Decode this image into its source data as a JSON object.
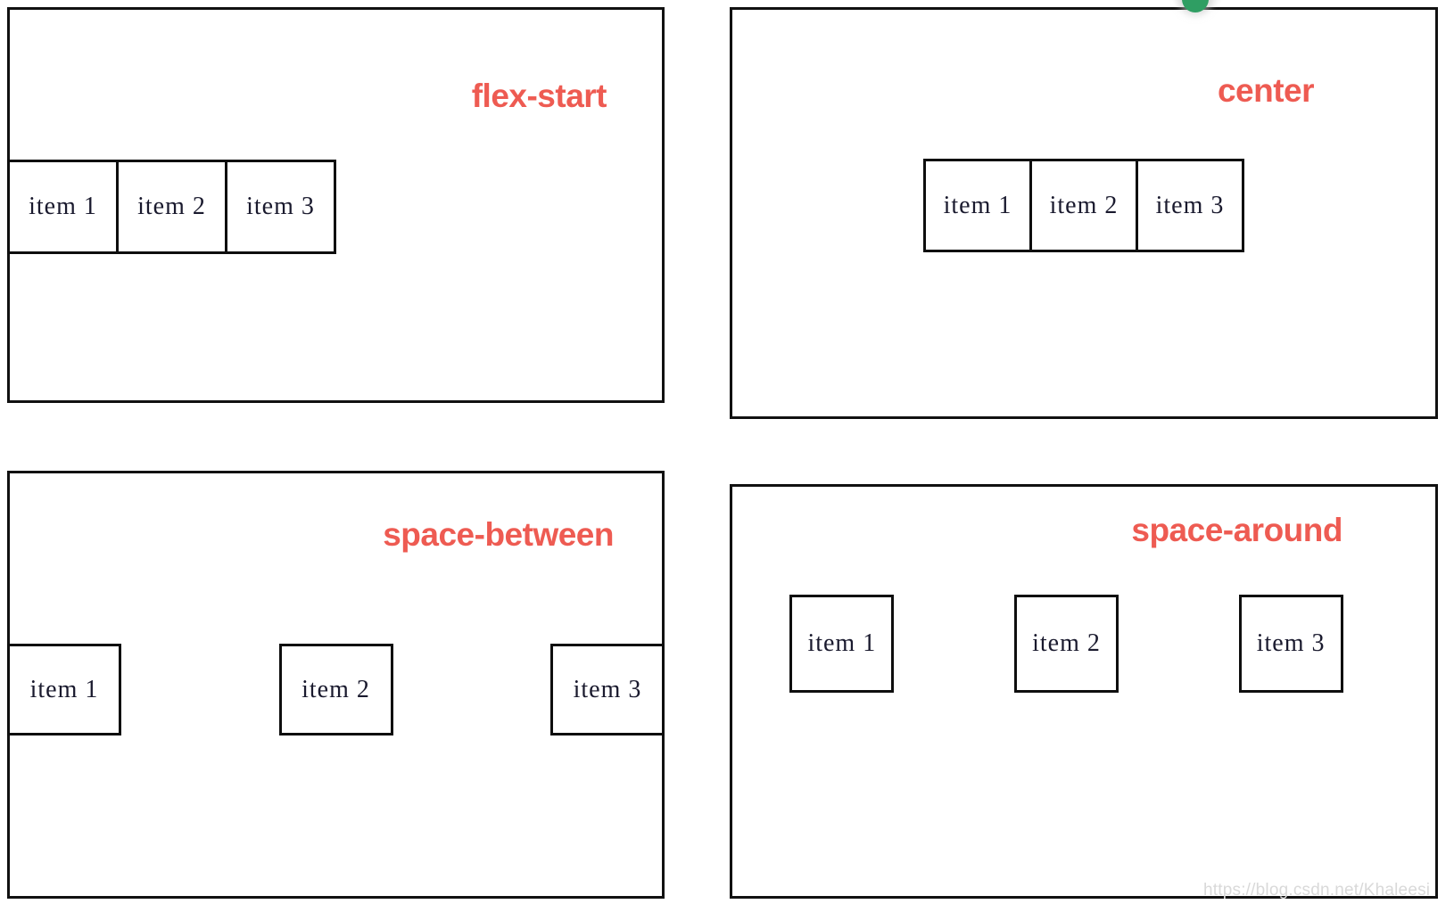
{
  "diagram": {
    "title": "CSS flexbox justify-content demonstration",
    "background_color": "#ffffff",
    "caption_color": "#ee5b52",
    "border_color": "#111111",
    "item_text_color": "#1a1a2e"
  },
  "panels": [
    {
      "id": "flex-start",
      "caption": "flex-start",
      "justify_content": "flex-start",
      "items": [
        {
          "label": "item 1"
        },
        {
          "label": "item 2"
        },
        {
          "label": "item 3"
        }
      ]
    },
    {
      "id": "center",
      "caption": "center",
      "justify_content": "center",
      "items": [
        {
          "label": "item 1"
        },
        {
          "label": "item 2"
        },
        {
          "label": "item 3"
        }
      ]
    },
    {
      "id": "space-between",
      "caption": "space-between",
      "justify_content": "space-between",
      "items": [
        {
          "label": "item 1"
        },
        {
          "label": "item 2"
        },
        {
          "label": "item 3"
        }
      ]
    },
    {
      "id": "space-around",
      "caption": "space-around",
      "justify_content": "space-around",
      "items": [
        {
          "label": "item 1"
        },
        {
          "label": "item 2"
        },
        {
          "label": "item 3"
        }
      ]
    }
  ],
  "artifacts": {
    "watermark": "https://blog.csdn.net/Khaleesi",
    "green_badge_icon": "green-circle-icon"
  }
}
